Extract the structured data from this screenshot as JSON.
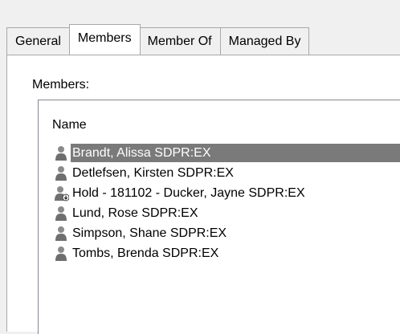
{
  "tabs": [
    "General",
    "Members",
    "Member Of",
    "Managed By"
  ],
  "active_tab_index": 1,
  "panel": {
    "members_label": "Members:",
    "column_header": "Name",
    "members": [
      {
        "name": "Brandt, Alissa SDPR:EX",
        "icon": "user-icon",
        "selected": true
      },
      {
        "name": "Detlefsen, Kirsten SDPR:EX",
        "icon": "user-icon",
        "selected": false
      },
      {
        "name": "Hold - 181102 - Ducker, Jayne SDPR:EX",
        "icon": "disabled-user-icon",
        "selected": false
      },
      {
        "name": "Lund, Rose SDPR:EX",
        "icon": "user-icon",
        "selected": false
      },
      {
        "name": "Simpson, Shane SDPR:EX",
        "icon": "user-icon",
        "selected": false
      },
      {
        "name": "Tombs, Brenda SDPR:EX",
        "icon": "user-icon",
        "selected": false
      }
    ]
  },
  "colors": {
    "selection": "#7a7a7a",
    "panel": "#ffffff",
    "window": "#f0f0f0"
  }
}
